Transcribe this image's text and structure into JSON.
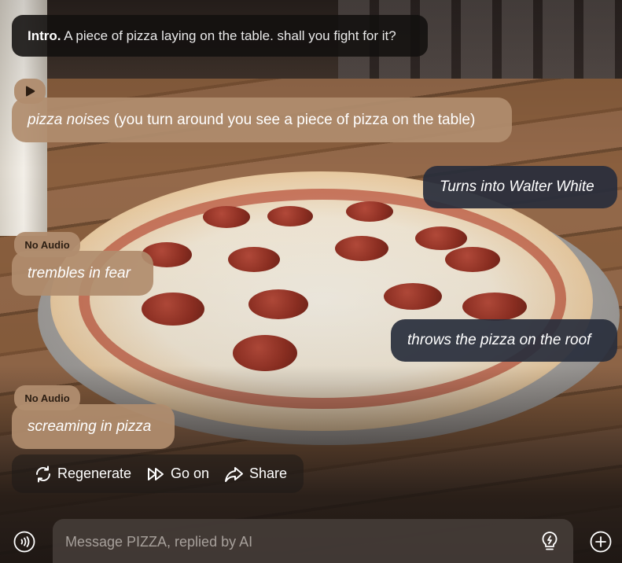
{
  "intro": {
    "label": "Intro.",
    "text": "A piece of pizza laying on the table. shall you fight for it?"
  },
  "messages": [
    {
      "role": "bot",
      "action": "pizza noises",
      "text": "(you turn around you see a piece of pizza on the table)",
      "badge_icon": "play-icon"
    },
    {
      "role": "user",
      "text": "Turns into Walter White"
    },
    {
      "role": "bot",
      "badge": "No Audio",
      "action": "trembles in fear"
    },
    {
      "role": "user",
      "text": "throws the pizza on the roof"
    },
    {
      "role": "bot",
      "badge": "No Audio",
      "action": "screaming in pizza"
    }
  ],
  "actions": {
    "regenerate": "Regenerate",
    "go_on": "Go on",
    "share": "Share"
  },
  "input": {
    "placeholder": "Message PIZZA, replied by AI"
  },
  "icons": [
    "play-icon",
    "regenerate-icon",
    "fast-forward-icon",
    "share-icon",
    "voice-icon",
    "lightbulb-icon",
    "plus-circle-icon"
  ],
  "colors": {
    "bot_bubble": "#b08d6e",
    "user_bubble": "#282e3c",
    "intro_bubble": "#12100f",
    "badge_text": "#2b1d12"
  }
}
